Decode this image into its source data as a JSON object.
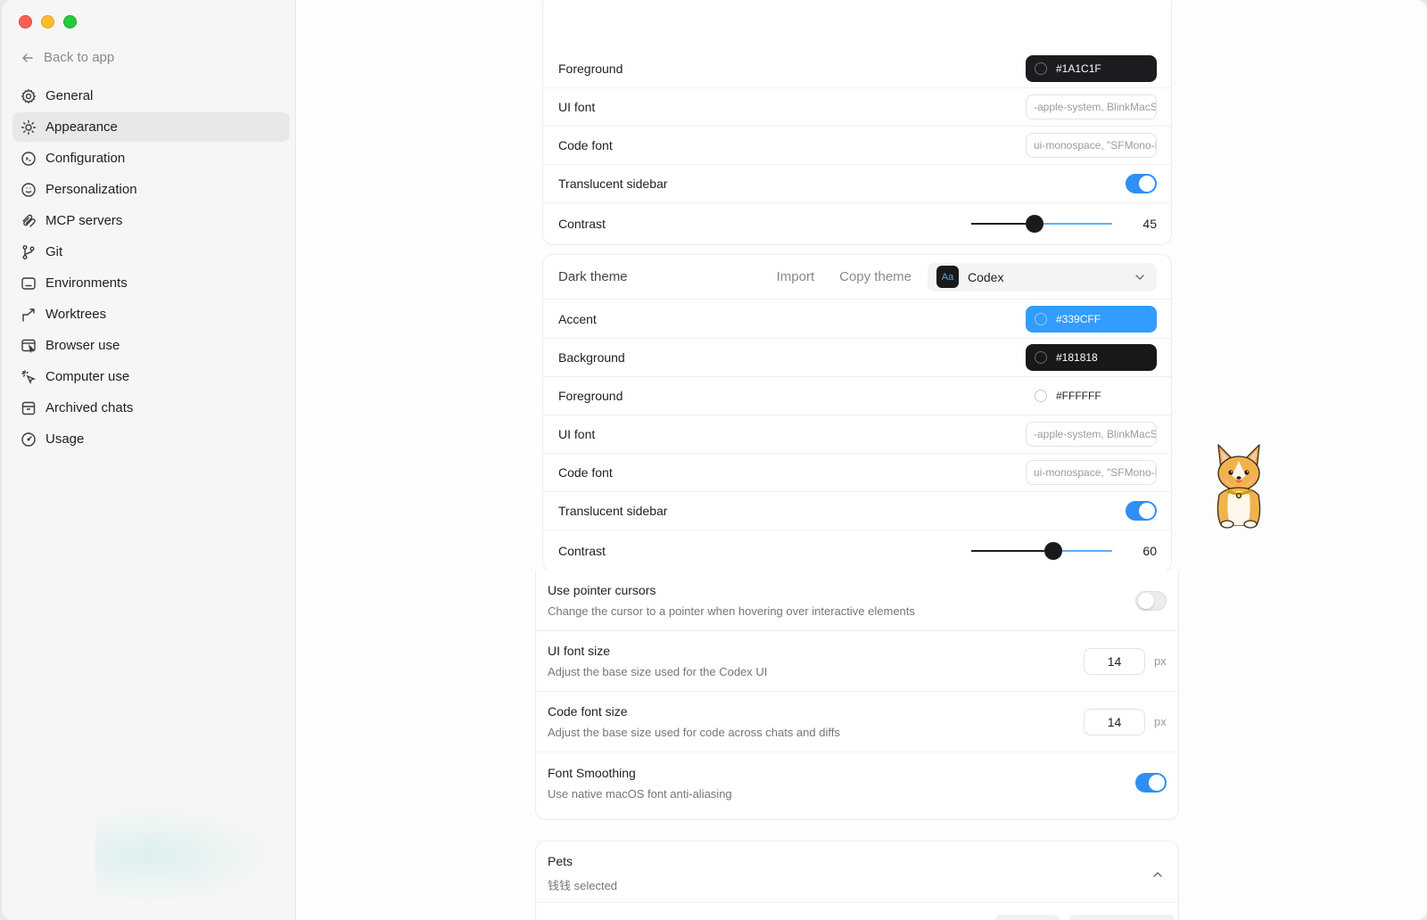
{
  "sidebar": {
    "back_label": "Back to app",
    "items": [
      {
        "label": "General",
        "icon": "gear-icon"
      },
      {
        "label": "Appearance",
        "icon": "sun-icon",
        "active": true
      },
      {
        "label": "Configuration",
        "icon": "config-icon"
      },
      {
        "label": "Personalization",
        "icon": "personalization-icon"
      },
      {
        "label": "MCP servers",
        "icon": "mcp-icon"
      },
      {
        "label": "Git",
        "icon": "git-branch-icon"
      },
      {
        "label": "Environments",
        "icon": "environments-icon"
      },
      {
        "label": "Worktrees",
        "icon": "worktrees-icon"
      },
      {
        "label": "Browser use",
        "icon": "browser-icon"
      },
      {
        "label": "Computer use",
        "icon": "cursor-click-icon"
      },
      {
        "label": "Archived chats",
        "icon": "archive-icon"
      },
      {
        "label": "Usage",
        "icon": "gauge-icon"
      }
    ]
  },
  "light_theme": {
    "foreground_label": "Foreground",
    "foreground_value": "#1A1C1F",
    "ui_font_label": "UI font",
    "ui_font_value": "-apple-system, BlinkMacSystemFont",
    "code_font_label": "Code font",
    "code_font_value": "ui-monospace, \"SFMono-Regular\"",
    "translucent_label": "Translucent sidebar",
    "translucent_on": true,
    "contrast_label": "Contrast",
    "contrast_value": "45"
  },
  "dark_theme": {
    "title": "Dark theme",
    "import_label": "Import",
    "copy_label": "Copy theme",
    "preset_badge": "Aa",
    "preset_name": "Codex",
    "accent_label": "Accent",
    "accent_value": "#339CFF",
    "background_label": "Background",
    "background_value": "#181818",
    "foreground_label": "Foreground",
    "foreground_value": "#FFFFFF",
    "ui_font_label": "UI font",
    "ui_font_value": "-apple-system, BlinkMacSystemFont",
    "code_font_label": "Code font",
    "code_font_value": "ui-monospace, \"SFMono-Regular\"",
    "translucent_label": "Translucent sidebar",
    "translucent_on": true,
    "contrast_label": "Contrast",
    "contrast_value": "60"
  },
  "settings": {
    "pointer_title": "Use pointer cursors",
    "pointer_desc": "Change the cursor to a pointer when hovering over interactive elements",
    "pointer_on": false,
    "ui_size_title": "UI font size",
    "ui_size_desc": "Adjust the base size used for the Codex UI",
    "ui_size_value": "14",
    "ui_size_unit": "px",
    "code_size_title": "Code font size",
    "code_size_desc": "Adjust the base size used for code across chats and diffs",
    "code_size_value": "14",
    "code_size_unit": "px",
    "smoothing_title": "Font Smoothing",
    "smoothing_desc": "Use native macOS font anti-aliasing",
    "smoothing_on": true
  },
  "pets": {
    "title": "Pets",
    "selected": "钱钱 selected"
  },
  "colors": {
    "accent": "#339CFF",
    "toggle_on": "#2F8FF4",
    "dark_swatch": "#1A1C1F"
  }
}
